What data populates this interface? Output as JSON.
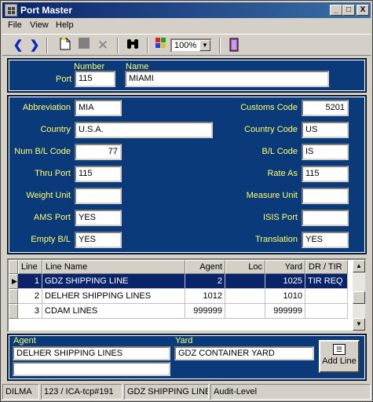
{
  "window": {
    "title": "Port Master",
    "minimize": "_",
    "maximize": "□",
    "close": "X"
  },
  "menu": [
    "File",
    "View",
    "Help"
  ],
  "toolbar": {
    "zoom": "100%"
  },
  "port": {
    "number_label": "Number",
    "name_label": "Name",
    "port_label": "Port",
    "number": "115",
    "name": "MIAMI"
  },
  "details": {
    "left": [
      {
        "label": "Abbreviation",
        "value": "MIA"
      },
      {
        "label": "Country",
        "value": "U.S.A."
      },
      {
        "label": "Num B/L Code",
        "value": "77"
      },
      {
        "label": "Thru Port",
        "value": "115"
      },
      {
        "label": "Weight Unit",
        "value": ""
      },
      {
        "label": "AMS Port",
        "value": "YES"
      },
      {
        "label": "Empty B/L",
        "value": "YES"
      }
    ],
    "right": [
      {
        "label": "Customs Code",
        "value": "5201"
      },
      {
        "label": "Country Code",
        "value": "US"
      },
      {
        "label": "B/L Code",
        "value": "IS"
      },
      {
        "label": "Rate As",
        "value": "115"
      },
      {
        "label": "Measure Unit",
        "value": ""
      },
      {
        "label": "ISIS Port",
        "value": ""
      },
      {
        "label": "Translation",
        "value": "YES"
      }
    ]
  },
  "grid": {
    "columns": [
      "Line",
      "Line Name",
      "Agent",
      "Loc",
      "Yard",
      "DR / TIR"
    ],
    "rows": [
      {
        "line": "1",
        "name": "GDZ SHIPPING LINE",
        "agent": "2",
        "loc": "",
        "yard": "1025",
        "drtir": "TIR REQ"
      },
      {
        "line": "2",
        "name": "DELHER SHIPPING LINES",
        "agent": "1012",
        "loc": "",
        "yard": "1010",
        "drtir": ""
      },
      {
        "line": "3",
        "name": "CDAM LINES",
        "agent": "999999",
        "loc": "",
        "yard": "999999",
        "drtir": ""
      }
    ]
  },
  "footer": {
    "agent_label": "Agent",
    "agent_value": "DELHER SHIPPING LINES",
    "agent_value2": "",
    "yard_label": "Yard",
    "yard_value": "GDZ CONTAINER YARD",
    "add_line": "Add Line"
  },
  "status": [
    "DILMA",
    "123 / ICA-tcp#191",
    "GDZ SHIPPING LINE",
    "Audit-Level"
  ],
  "colors": {
    "panel": "#0a3a7a",
    "label": "#ffff66",
    "selection": "#0a246a"
  }
}
